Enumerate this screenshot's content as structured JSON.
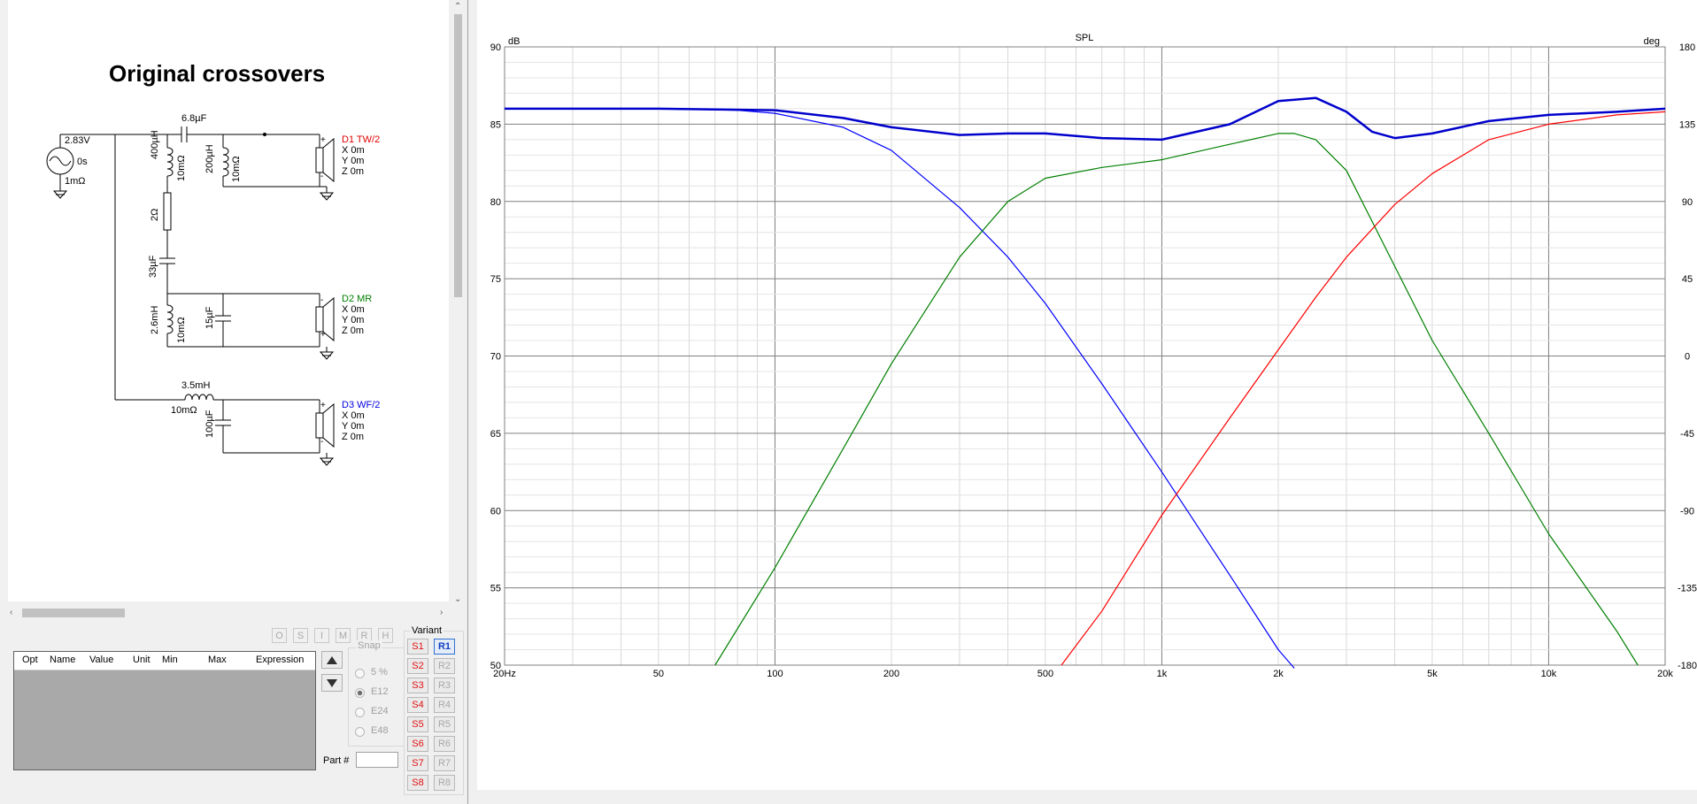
{
  "schematic": {
    "title": "Original crossovers",
    "source": {
      "voltage": "2.83V",
      "delay": "0s",
      "resistance": "1mΩ"
    },
    "drivers": [
      {
        "name": "D1 TW/2",
        "color": "#e00000",
        "x": "X 0m",
        "y": "Y 0m",
        "z": "Z 0m"
      },
      {
        "name": "D2 MR",
        "color": "#008000",
        "x": "X 0m",
        "y": "Y 0m",
        "z": "Z 0m"
      },
      {
        "name": "D3 WF/2",
        "color": "#0000e0",
        "x": "X 0m",
        "y": "Y 0m",
        "z": "Z 0m"
      }
    ],
    "components": {
      "c_tw": "6.8µF",
      "l_tw_shunt": "400µH",
      "l_tw_shunt_r": "10mΩ",
      "l_tw_par": "200µH",
      "l_tw_par_r": "10mΩ",
      "r_mr": "2Ω",
      "c_mr": "33µF",
      "l_mr": "2.6mH",
      "l_mr_r": "10mΩ",
      "c_mr_shunt": "15µF",
      "l_wf": "3.5mH",
      "l_wf_r": "10mΩ",
      "c_wf": "100µF"
    },
    "pin_plus": "+",
    "pin_minus": "-"
  },
  "toolbar": {
    "buttons": [
      "O",
      "S",
      "I",
      "M",
      "R",
      "H"
    ]
  },
  "param_table": {
    "columns": [
      "Opt",
      "Name",
      "Value",
      "Unit",
      "Min",
      "Max",
      "Expression"
    ]
  },
  "snap": {
    "label": "Snap",
    "options": [
      "5 %",
      "E12",
      "E24",
      "E48"
    ],
    "selected": "E12"
  },
  "part_label": "Part #",
  "variant": {
    "label": "Variant",
    "s": [
      "S1",
      "S2",
      "S3",
      "S4",
      "S5",
      "S6",
      "S7",
      "S8"
    ],
    "r": [
      "R1",
      "R2",
      "R3",
      "R4",
      "R5",
      "R6",
      "R7",
      "R8"
    ],
    "active": "R1"
  },
  "chart_data": {
    "type": "line",
    "title": "SPL",
    "ylabel": "dB",
    "y2label": "deg",
    "x_scale": "log",
    "xlim": [
      20,
      20000
    ],
    "ylim": [
      50,
      90
    ],
    "y2lim": [
      -180,
      180
    ],
    "x_ticks": [
      20,
      50,
      100,
      200,
      500,
      1000,
      2000,
      5000,
      10000,
      20000
    ],
    "x_tick_labels": [
      "20Hz",
      "50",
      "100",
      "200",
      "500",
      "1k",
      "2k",
      "5k",
      "10k",
      "20k"
    ],
    "y_ticks": [
      90,
      85,
      80,
      75,
      70,
      65,
      60,
      55,
      50
    ],
    "y2_ticks": [
      180,
      135,
      90,
      45,
      0,
      -45,
      -90,
      -135,
      -180
    ],
    "grid": true,
    "series": [
      {
        "color": "#0000ff",
        "x": [
          20,
          50,
          80,
          100,
          150,
          200,
          300,
          400,
          500,
          700,
          1000,
          1500,
          2000,
          2200
        ],
        "y": [
          86.0,
          86.0,
          85.9,
          85.7,
          84.8,
          83.3,
          79.6,
          76.4,
          73.4,
          68.2,
          62.5,
          55.8,
          51.0,
          49.8
        ]
      },
      {
        "color": "#008000",
        "x": [
          70,
          100,
          150,
          200,
          300,
          400,
          500,
          700,
          1000,
          1500,
          2000,
          2200,
          2500,
          3000,
          4000,
          5000,
          7000,
          10000,
          15000,
          17000
        ],
        "y": [
          50.0,
          56.3,
          64.0,
          69.5,
          76.4,
          80.0,
          81.5,
          82.2,
          82.7,
          83.7,
          84.4,
          84.4,
          84.0,
          82.0,
          75.8,
          71.0,
          65.0,
          58.5,
          52.2,
          50.0
        ]
      },
      {
        "color": "#ff0000",
        "x": [
          550,
          700,
          1000,
          1500,
          2000,
          2500,
          3000,
          4000,
          5000,
          7000,
          10000,
          15000,
          20000
        ],
        "y": [
          50.0,
          53.5,
          59.7,
          66.0,
          70.4,
          73.8,
          76.4,
          79.8,
          81.8,
          84.0,
          85.0,
          85.6,
          85.8
        ]
      },
      {
        "color": "#0000cc",
        "name_visible": false,
        "x": [
          20,
          50,
          100,
          150,
          200,
          300,
          400,
          500,
          700,
          1000,
          1500,
          2000,
          2500,
          3000,
          3500,
          4000,
          5000,
          7000,
          10000,
          15000,
          20000
        ],
        "y": [
          86.0,
          86.0,
          85.9,
          85.4,
          84.8,
          84.3,
          84.4,
          84.4,
          84.1,
          84.0,
          85.0,
          86.5,
          86.7,
          85.8,
          84.5,
          84.1,
          84.4,
          85.2,
          85.6,
          85.8,
          86.0
        ]
      }
    ]
  }
}
